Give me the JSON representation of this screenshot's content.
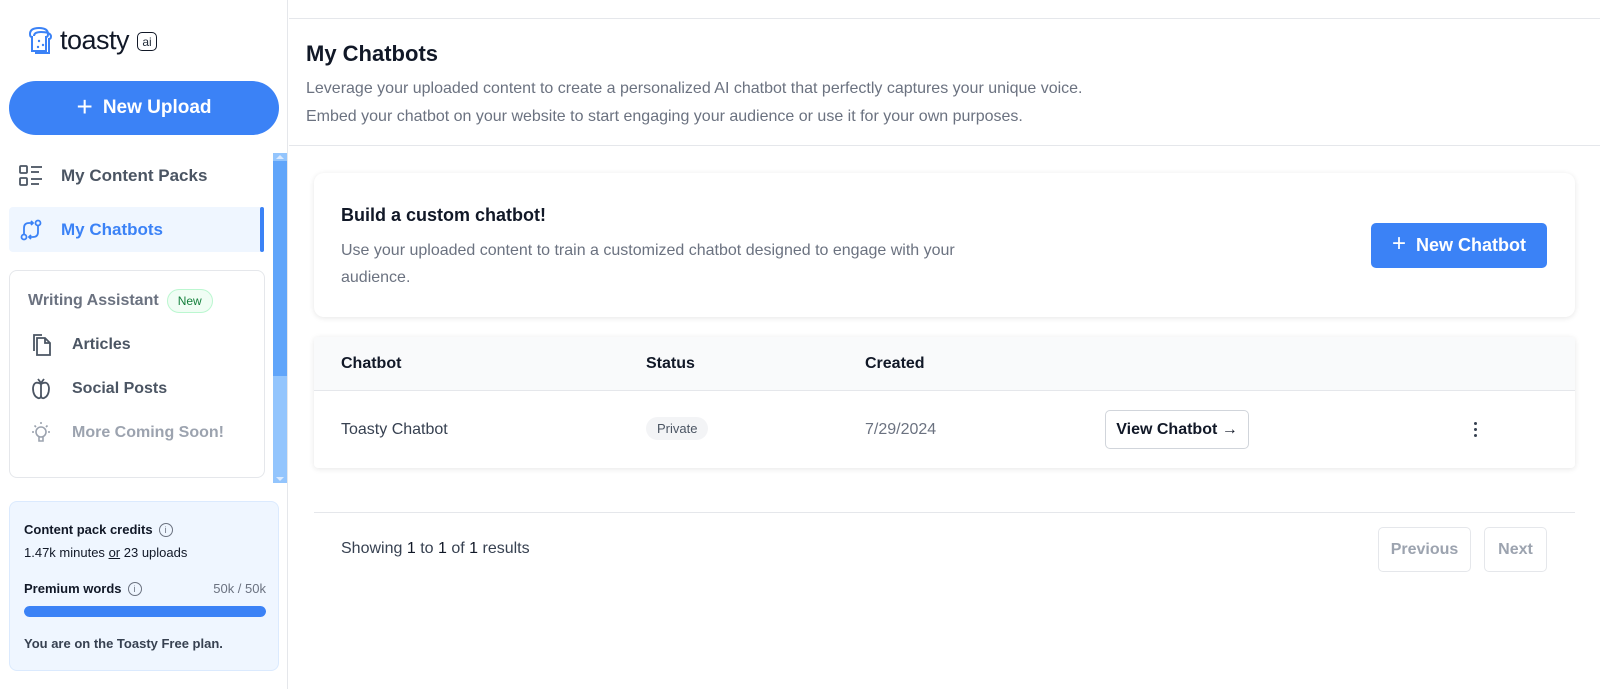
{
  "brand": {
    "name": "toasty",
    "badge": "ai"
  },
  "sidebar": {
    "new_upload_label": "New Upload",
    "nav": [
      {
        "label": "My Content Packs",
        "icon": "list-icon",
        "active": false
      },
      {
        "label": "My Chatbots",
        "icon": "chatbot-arrows-icon",
        "active": true
      }
    ],
    "writing_assistant": {
      "title": "Writing Assistant",
      "badge": "New",
      "items": [
        {
          "label": "Articles",
          "icon": "documents-icon"
        },
        {
          "label": "Social Posts",
          "icon": "social-icon"
        },
        {
          "label": "More Coming Soon!",
          "icon": "lightbulb-icon"
        }
      ]
    },
    "credits": {
      "title": "Content pack credits",
      "minutes": "1.47k minutes",
      "or": "or",
      "uploads": "23 uploads",
      "premium_label": "Premium words",
      "premium_value": "50k / 50k",
      "premium_fraction": 1.0,
      "plan_text": "You are on the Toasty Free plan."
    }
  },
  "main": {
    "title": "My Chatbots",
    "description_line1": "Leverage your uploaded content to create a personalized AI chatbot that perfectly captures your unique voice.",
    "description_line2": "Embed your chatbot on your website to start engaging your audience or use it for your own purposes.",
    "build_card": {
      "title": "Build a custom chatbot!",
      "description": "Use your uploaded content to train a customized chatbot designed to engage with your audience.",
      "button_label": "New Chatbot"
    },
    "table": {
      "headers": [
        "Chatbot",
        "Status",
        "Created"
      ],
      "rows": [
        {
          "name": "Toasty Chatbot",
          "status": "Private",
          "created": "7/29/2024",
          "action": "View Chatbot →"
        }
      ]
    },
    "pagination": {
      "showing_prefix": "Showing",
      "from": "1",
      "to_word": "to",
      "to": "1",
      "of_word": "of",
      "total": "1",
      "results_word": "results",
      "previous": "Previous",
      "next": "Next"
    }
  },
  "colors": {
    "accent": "#3b82f6",
    "accent_light": "#eff6ff"
  }
}
